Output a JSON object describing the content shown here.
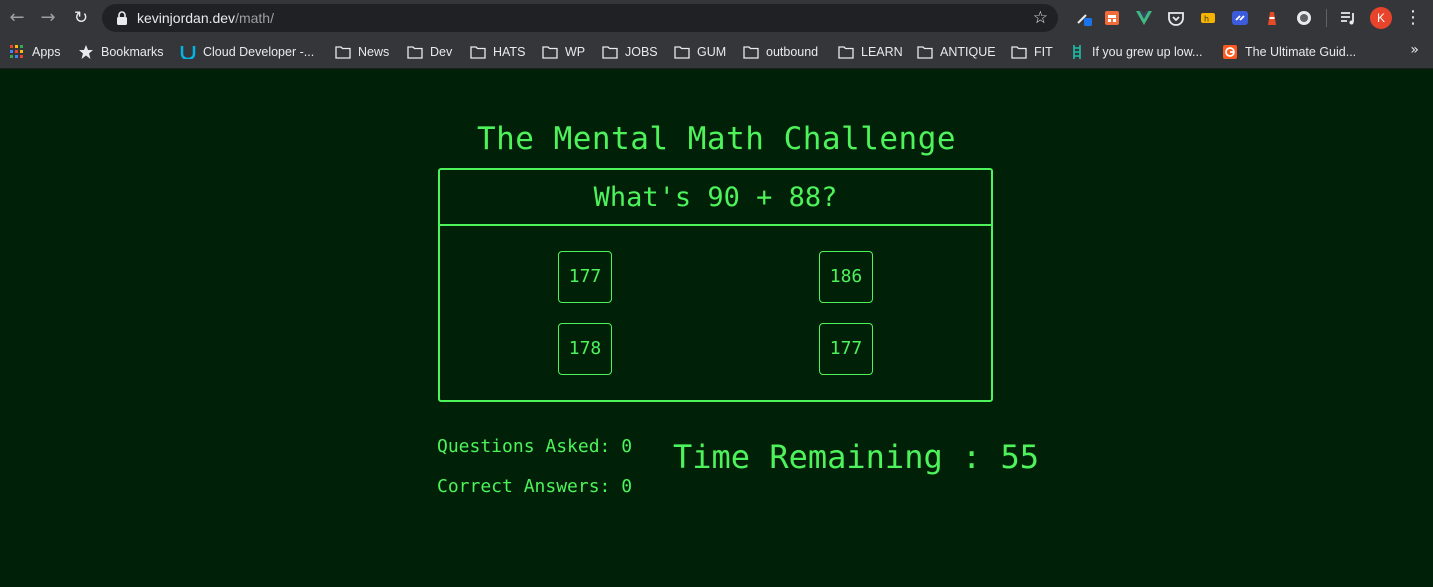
{
  "browser": {
    "url_host": "kevinjordan.dev",
    "url_path": "/math/",
    "avatar_letter": "K",
    "bookmarks": [
      {
        "label": "Apps",
        "icon": "apps-grid-icon"
      },
      {
        "label": "Bookmarks",
        "icon": "star-icon"
      },
      {
        "label": "Cloud Developer -...",
        "icon": "udacity-icon"
      },
      {
        "label": "News",
        "icon": "folder-icon"
      },
      {
        "label": "Dev",
        "icon": "folder-icon"
      },
      {
        "label": "HATS",
        "icon": "folder-icon"
      },
      {
        "label": "WP",
        "icon": "folder-icon"
      },
      {
        "label": "JOBS",
        "icon": "folder-icon"
      },
      {
        "label": "GUM",
        "icon": "folder-icon"
      },
      {
        "label": "outbound",
        "icon": "folder-icon"
      },
      {
        "label": "LEARN",
        "icon": "folder-icon"
      },
      {
        "label": "ANTIQUE",
        "icon": "folder-icon"
      },
      {
        "label": "FIT",
        "icon": "folder-icon"
      },
      {
        "label": "If you grew up low...",
        "icon": "ladder-icon"
      },
      {
        "label": "The Ultimate Guid...",
        "icon": "g-logo-icon"
      }
    ],
    "overflow_label": "»"
  },
  "game": {
    "title": "The Mental Math Challenge",
    "question": "What's 90 + 88?",
    "answers": [
      "177",
      "186",
      "178",
      "177"
    ],
    "questions_asked_label": "Questions Asked: 0",
    "correct_answers_label": "Correct Answers: 0",
    "time_remaining_label": "Time Remaining : 55"
  },
  "colors": {
    "page_background": "#002107",
    "accent_green": "#4ef25b",
    "chrome_bar": "#35363a"
  }
}
